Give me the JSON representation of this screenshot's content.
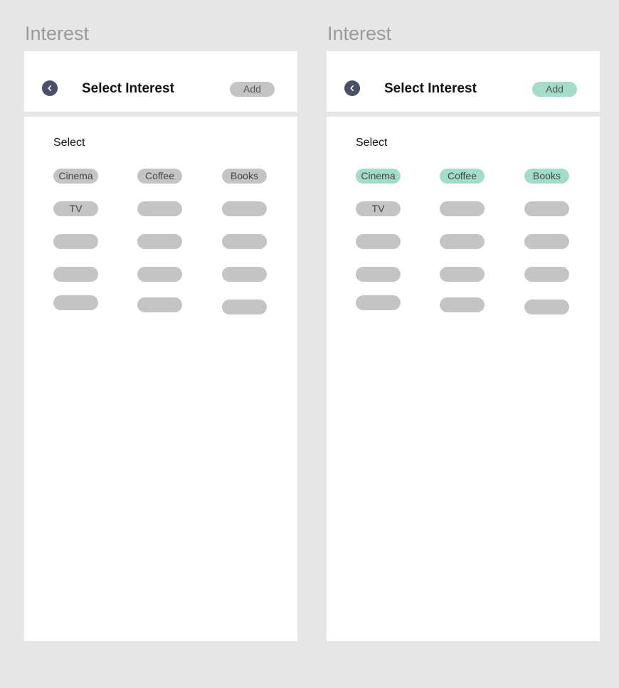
{
  "screens": [
    {
      "board_title": "Interest",
      "header": {
        "title": "Select Interest",
        "add_label": "Add",
        "add_state": "inactive"
      },
      "content": {
        "select_label": "Select",
        "chips": [
          {
            "label": "Cinema",
            "selected": false
          },
          {
            "label": "Coffee",
            "selected": false
          },
          {
            "label": "Books",
            "selected": false
          },
          {
            "label": "TV",
            "selected": false
          },
          {
            "label": "",
            "selected": false
          },
          {
            "label": "",
            "selected": false
          },
          {
            "label": "",
            "selected": false
          },
          {
            "label": "",
            "selected": false
          },
          {
            "label": "",
            "selected": false
          },
          {
            "label": "",
            "selected": false
          },
          {
            "label": "",
            "selected": false
          },
          {
            "label": "",
            "selected": false
          },
          {
            "label": "",
            "selected": false
          },
          {
            "label": "",
            "selected": false
          },
          {
            "label": "",
            "selected": false
          }
        ]
      }
    },
    {
      "board_title": "Interest",
      "header": {
        "title": "Select Interest",
        "add_label": "Add",
        "add_state": "active"
      },
      "content": {
        "select_label": "Select",
        "chips": [
          {
            "label": "Cinema",
            "selected": true
          },
          {
            "label": "Coffee",
            "selected": true
          },
          {
            "label": "Books",
            "selected": true
          },
          {
            "label": "TV",
            "selected": false
          },
          {
            "label": "",
            "selected": false
          },
          {
            "label": "",
            "selected": false
          },
          {
            "label": "",
            "selected": false
          },
          {
            "label": "",
            "selected": false
          },
          {
            "label": "",
            "selected": false
          },
          {
            "label": "",
            "selected": false
          },
          {
            "label": "",
            "selected": false
          },
          {
            "label": "",
            "selected": false
          },
          {
            "label": "",
            "selected": false
          },
          {
            "label": "",
            "selected": false
          },
          {
            "label": "",
            "selected": false
          }
        ]
      }
    }
  ],
  "icons": {
    "back": "chevron-left-icon"
  },
  "colors": {
    "background": "#e6e6e6",
    "card": "#ffffff",
    "chip_default": "#c4c4c4",
    "chip_selected": "#a3dcc8",
    "back_button": "#4a4f6a",
    "board_title": "#9a9a9a"
  }
}
